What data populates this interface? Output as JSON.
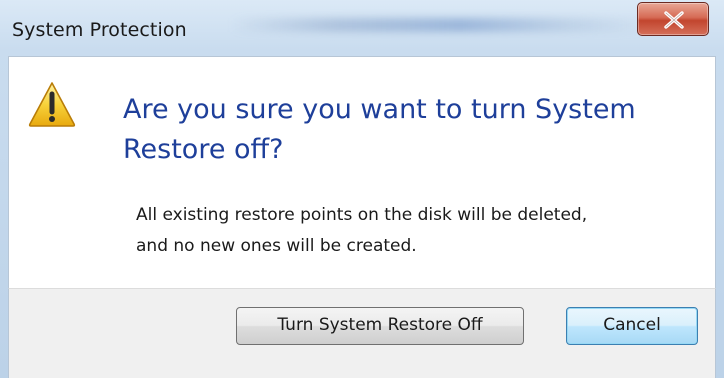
{
  "window": {
    "title": "System Protection",
    "close_icon": "close-icon"
  },
  "dialog": {
    "icon": "warning-icon",
    "heading": "Are you sure you want to turn System Restore off?",
    "message_line1": "All existing restore points on the disk will be deleted,",
    "message_line2": "and no new ones will be created."
  },
  "buttons": {
    "confirm_label": "Turn System Restore Off",
    "cancel_label": "Cancel"
  },
  "colors": {
    "heading": "#1e3f9a",
    "close_button": "#c2452e",
    "footer_bg": "#f0f0f0"
  }
}
